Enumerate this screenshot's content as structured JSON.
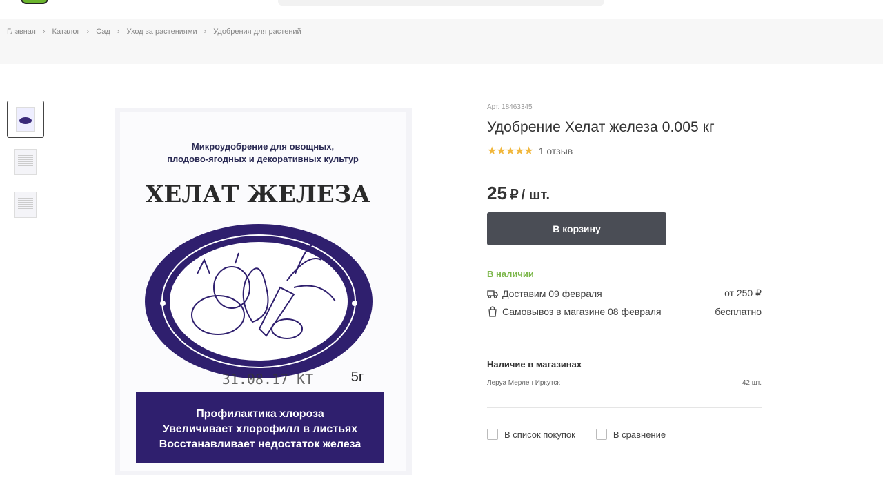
{
  "breadcrumbs": [
    "Главная",
    "Каталог",
    "Сад",
    "Уход за растениями",
    "Удобрения для растений"
  ],
  "product": {
    "sku": "Арт. 18463345",
    "title": "Удобрение Хелат железа 0.005 кг",
    "rating_stars": "★★★★★",
    "reviews": "1 отзыв",
    "price": "25",
    "currency": "₽",
    "unit": "/ шт.",
    "cart_button": "В корзину"
  },
  "image": {
    "line1": "Микроудобрение для овощных,",
    "line2": "плодово-ягодных и декоративных  культур",
    "name": "ХЕЛАТ ЖЕЛЕЗА",
    "stamp": "31.08.17 КТ",
    "weight": "5г",
    "band1": "Профилактика хлороза",
    "band2": "Увеличивает хлорофилл  в листьях",
    "band3": "Восстанавливает недостаток железа"
  },
  "availability": {
    "status": "В наличии",
    "delivery_label": "Доставим 09 февраля",
    "delivery_price": "от 250 ₽",
    "pickup_label": "Самовывоз в магазине 08 февраля",
    "pickup_price": "бесплатно"
  },
  "stores": {
    "title": "Наличие в магазинах",
    "store_name": "Леруа Мерлен Иркутск",
    "store_qty": "42 шт."
  },
  "actions": {
    "shopping_list": "В список покупок",
    "compare": "В сравнение"
  },
  "colors": {
    "accent_green": "#7ab648",
    "button_dark": "#4a4d55",
    "star": "#f1b73c",
    "package_purple": "#2f1f6e"
  }
}
